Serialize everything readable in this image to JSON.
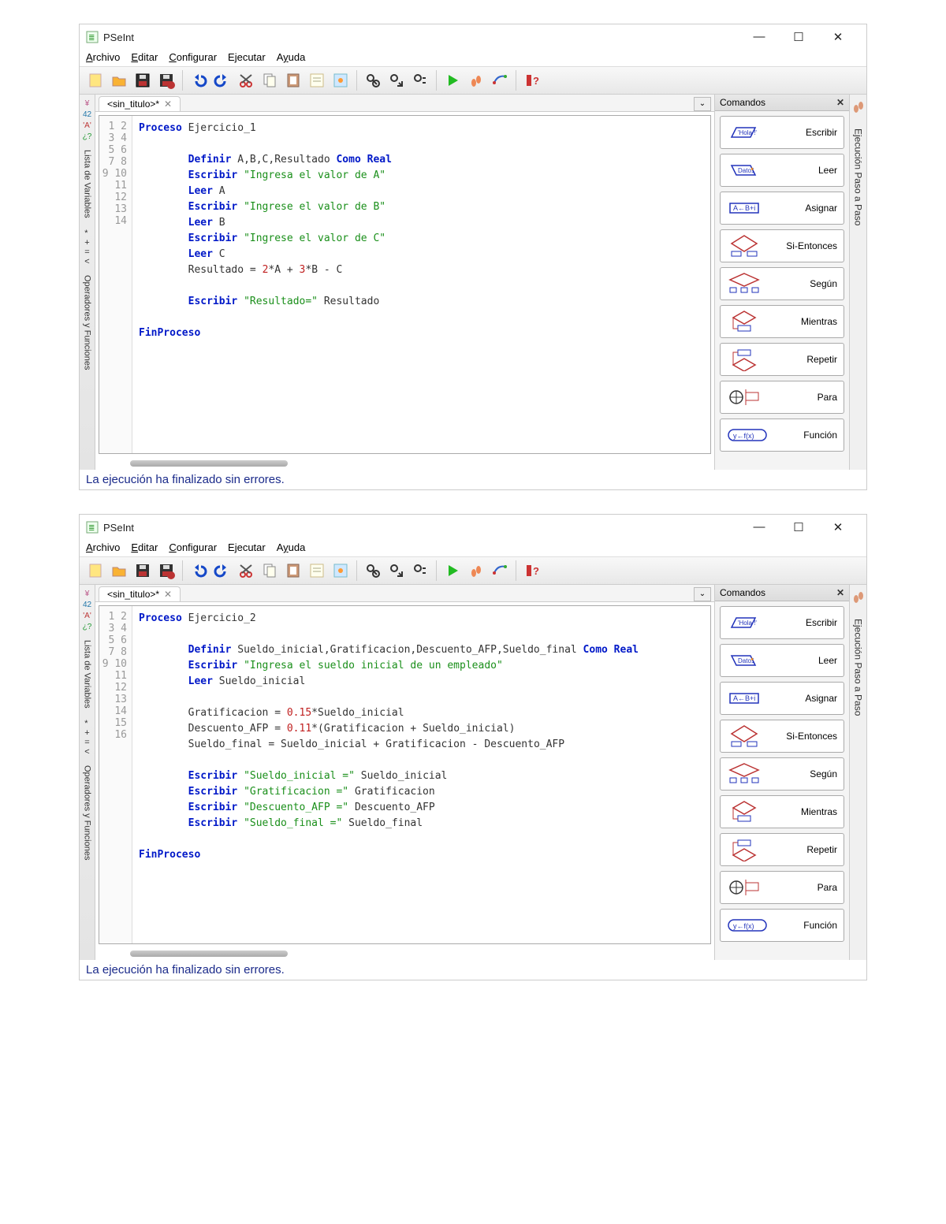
{
  "app_title": "PSeInt",
  "menus": [
    "Archivo",
    "Editar",
    "Configurar",
    "Ejecutar",
    "Ayuda"
  ],
  "tab_label": "<sin_titulo>*",
  "commands_title": "Comandos",
  "commands": [
    "Escribir",
    "Leer",
    "Asignar",
    "Si-Entonces",
    "Según",
    "Mientras",
    "Repetir",
    "Para",
    "Función"
  ],
  "left_labels": [
    "Lista de Variables",
    "Operadores y Funciones"
  ],
  "right_label": "Ejecución Paso a Paso",
  "status": "La ejecución ha finalizado sin errores.",
  "win1": {
    "lines": 14,
    "code_html": "<span class='kw'>Proceso</span> <span class='ident'>Ejercicio_1</span>\n\t\n\t<span class='kw'>Definir</span> <span class='ident'>A,B,C,Resultado</span> <span class='kw'>Como Real</span>\n\t<span class='kw'>Escribir</span> <span class='str'>\"Ingresa el valor de A\"</span>\n\t<span class='kw'>Leer</span> <span class='ident'>A</span>\n\t<span class='kw'>Escribir</span> <span class='str'>\"Ingrese el valor de B\"</span>\n\t<span class='kw'>Leer</span> <span class='ident'>B</span>\n\t<span class='kw'>Escribir</span> <span class='str'>\"Ingrese el valor de C\"</span>\n\t<span class='kw'>Leer</span> <span class='ident'>C</span>\n\t<span class='ident'>Resultado</span> = <span class='num'>2</span>*<span class='ident'>A</span> + <span class='num'>3</span>*<span class='ident'>B</span> - <span class='ident'>C</span>\n\t\n\t<span class='kw'>Escribir</span> <span class='str'>\"Resultado=\"</span> <span class='ident'>Resultado</span>\n\t\n<span class='kw'>FinProceso</span>"
  },
  "win2": {
    "lines": 16,
    "code_html": "<span class='kw'>Proceso</span> <span class='ident'>Ejercicio_2</span>\n\t\n\t<span class='kw'>Definir</span> <span class='ident'>Sueldo_inicial,Gratificacion,Descuento_AFP,Sueldo_final</span> <span class='kw'>Como Real</span>\n\t<span class='kw'>Escribir</span> <span class='str'>\"Ingresa el sueldo inicial de un empleado\"</span>\n\t<span class='kw'>Leer</span> <span class='ident'>Sueldo_inicial</span>\n\t\n\t<span class='ident'>Gratificacion</span> = <span class='num'>0.15</span>*<span class='ident'>Sueldo_inicial</span>\n\t<span class='ident'>Descuento_AFP</span> = <span class='num'>0.11</span>*(<span class='ident'>Gratificacion</span> + <span class='ident'>Sueldo_inicial</span>)\n\t<span class='ident'>Sueldo_final</span> = <span class='ident'>Sueldo_inicial</span> + <span class='ident'>Gratificacion</span> - <span class='ident'>Descuento_AFP</span>\n\t\n\t<span class='kw'>Escribir</span> <span class='str'>\"Sueldo_inicial =\"</span> <span class='ident'>Sueldo_inicial</span>\n\t<span class='kw'>Escribir</span> <span class='str'>\"Gratificacion =\"</span> <span class='ident'>Gratificacion</span>\n\t<span class='kw'>Escribir</span> <span class='str'>\"Descuento_AFP =\"</span> <span class='ident'>Descuento_AFP</span>\n\t<span class='kw'>Escribir</span> <span class='str'>\"Sueldo_final =\"</span> <span class='ident'>Sueldo_final</span>\n\t\n<span class='kw'>FinProceso</span>"
  }
}
